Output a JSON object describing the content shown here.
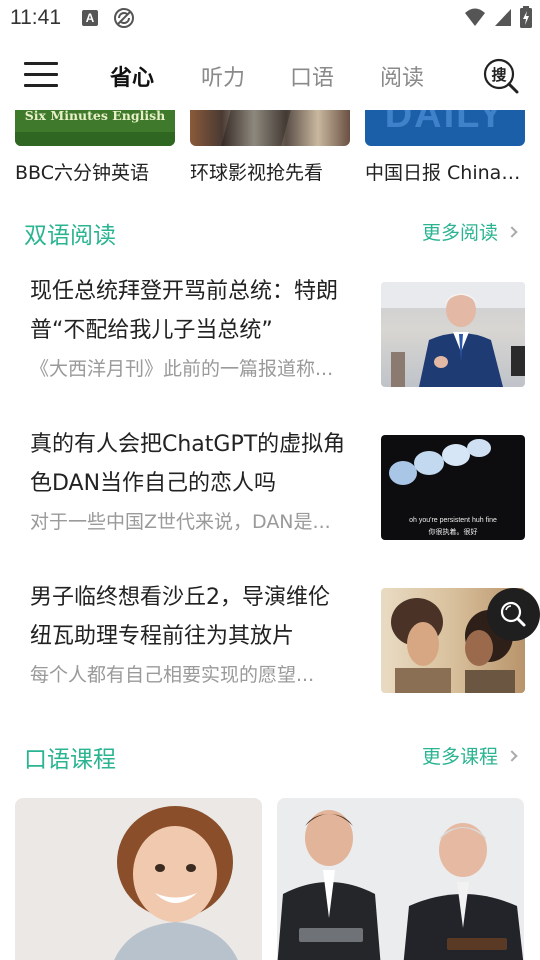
{
  "status_bar": {
    "time": "11:41",
    "icons": [
      "a-notification-icon",
      "sync-off-icon",
      "wifi-icon",
      "signal-icon",
      "battery-charging-icon"
    ]
  },
  "nav": {
    "tabs": [
      {
        "label": "省心",
        "active": true
      },
      {
        "label": "听力",
        "active": false
      },
      {
        "label": "口语",
        "active": false
      },
      {
        "label": "阅读",
        "active": false
      }
    ],
    "search_icon_text": "搜"
  },
  "top_cards": [
    {
      "label": "BBC六分钟英语",
      "image_text": "Six Minutes English"
    },
    {
      "label": "环球影视抢先看"
    },
    {
      "label": "中国日报 China Daily",
      "image_text": "DAILY"
    }
  ],
  "bilingual": {
    "title": "双语阅读",
    "more": "更多阅读",
    "articles": [
      {
        "title": "现任总统拜登开骂前总统：特朗普“不配给我儿子当总统”",
        "summary": "《大西洋月刊》此前的一篇报道称..."
      },
      {
        "title": "真的有人会把ChatGPT的虚拟角色DAN当作自己的恋人吗",
        "summary": "对于一些中国Z世代来说，DAN是...",
        "image_subtitle_en": "oh you're persistent huh fine",
        "image_subtitle_zh": "你很执着。很好"
      },
      {
        "title": "男子临终想看沙丘2，导演维伦纽瓦助理专程前往为其放片",
        "summary": "每个人都有自己相要实现的愿望..."
      }
    ]
  },
  "speaking": {
    "title": "口语课程",
    "more": "更多课程"
  },
  "colors": {
    "accent": "#2bb491",
    "text": "#222222",
    "muted": "#9a9a9a",
    "inactive_tab": "#8a8a8a"
  }
}
